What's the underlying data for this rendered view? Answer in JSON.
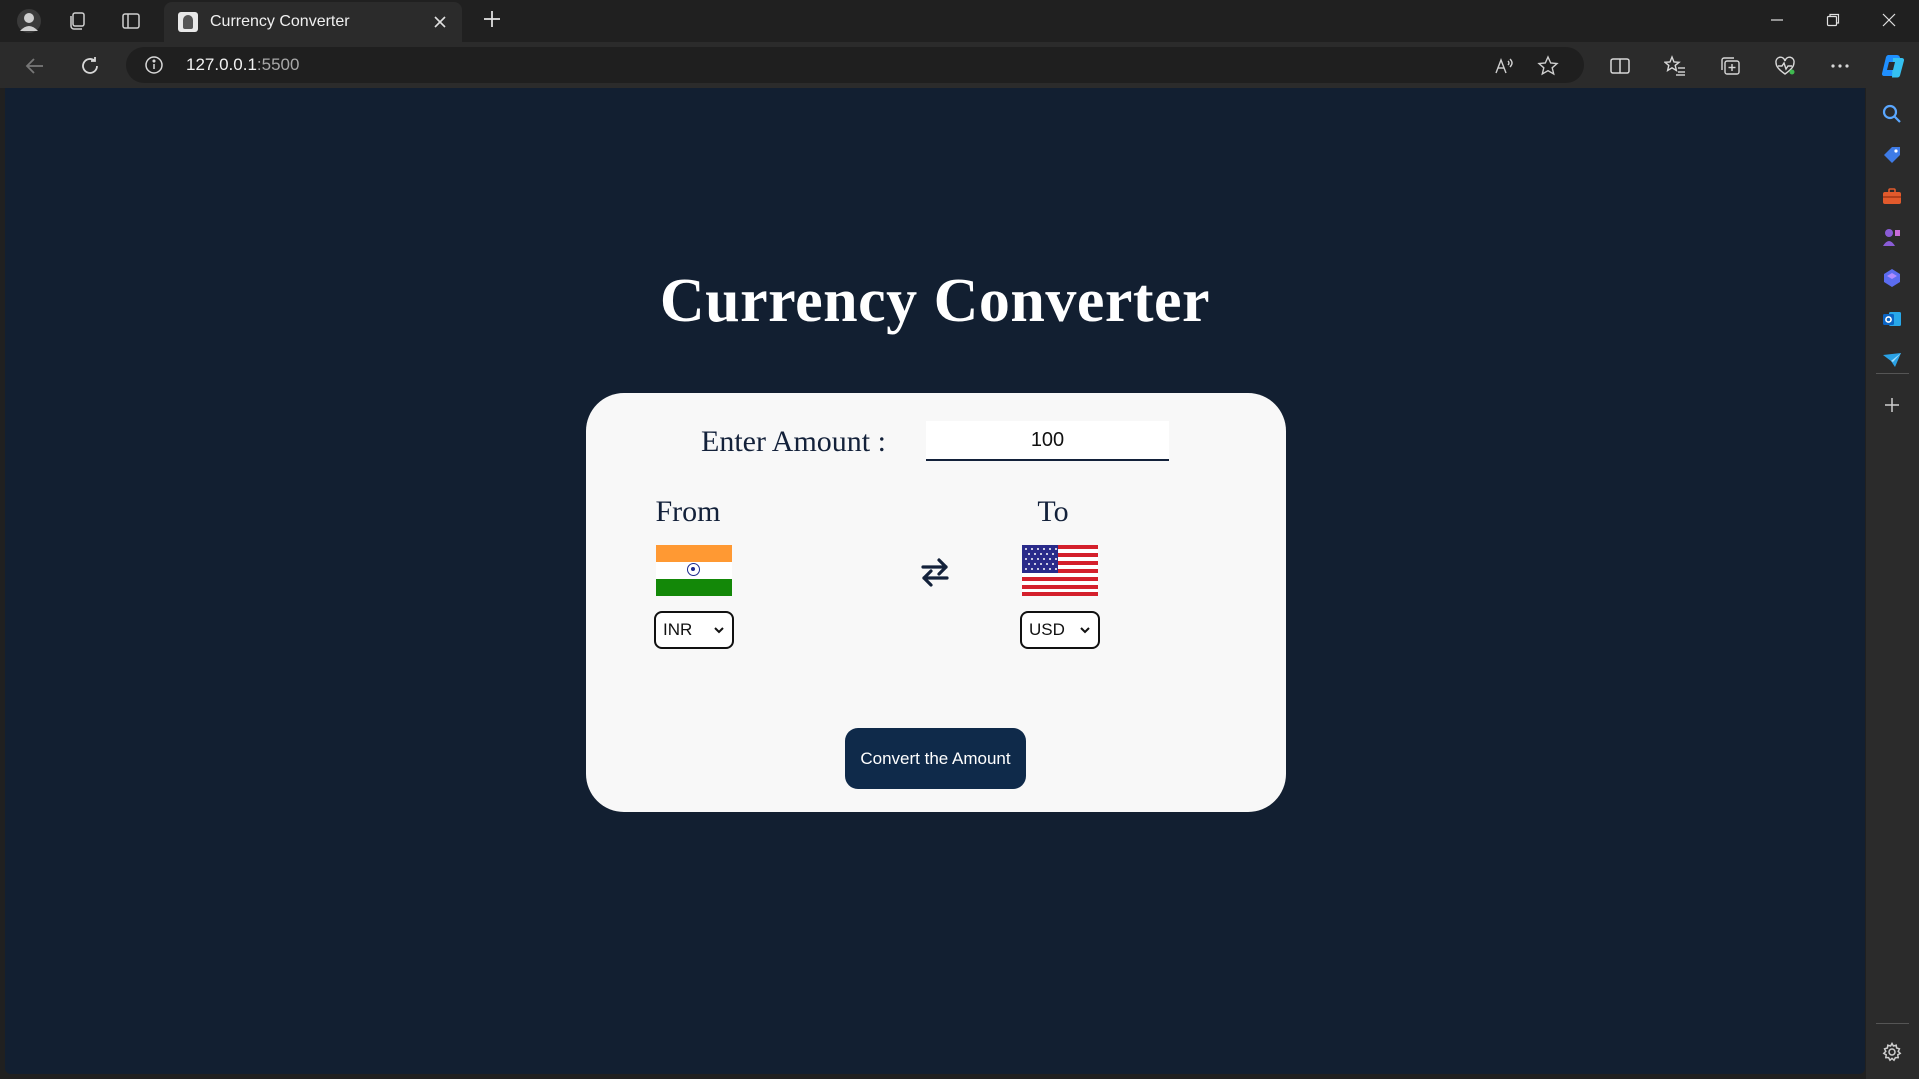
{
  "browser": {
    "tab": {
      "title": "Currency Converter"
    },
    "address": {
      "host": "127.0.0.1",
      "port": ":5500"
    }
  },
  "page": {
    "title": "Currency Converter",
    "amount": {
      "label": "Enter Amount :",
      "value": "100"
    },
    "from": {
      "label": "From",
      "currency": "INR",
      "flag": "india-flag"
    },
    "to": {
      "label": "To",
      "currency": "USD",
      "flag": "usa-flag"
    },
    "swap_icon": "swap-arrows-icon",
    "convert_button": "Convert the Amount"
  },
  "colors": {
    "page_background": "#121f31",
    "card_background": "#f8f8f8",
    "button_background": "#0f2a4a",
    "text_dark": "#13213a"
  }
}
